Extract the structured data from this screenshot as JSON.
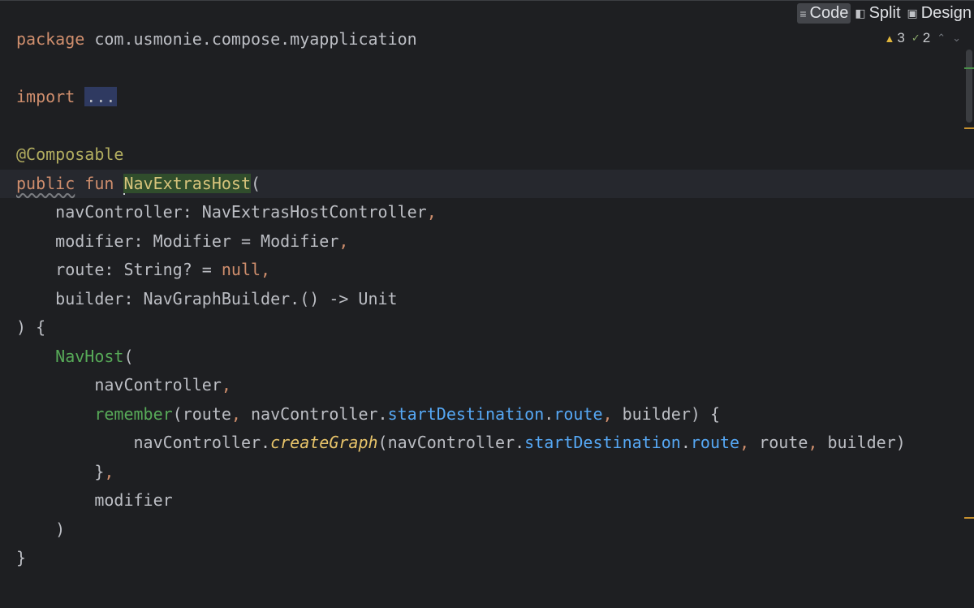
{
  "view_modes": [
    {
      "label": "Code",
      "icon": "lines-icon",
      "active": true
    },
    {
      "label": "Split",
      "icon": "split-icon",
      "active": false
    },
    {
      "label": "Design",
      "icon": "image-icon",
      "active": false
    }
  ],
  "inspections": {
    "warnings": "3",
    "weak_warnings": "2"
  },
  "colors": {
    "background": "#1e1f22",
    "keyword": "#cf8e6d",
    "annotation": "#b3ae60",
    "function_call": "#57aa58",
    "property_ref": "#56a8f5",
    "declaration_highlight": "#304d2c",
    "fold_highlight": "#2f3a61",
    "warning": "#e0b63c"
  },
  "code": {
    "l1_kw": "package",
    "l1_rest": " com.usmonie.compose.myapplication",
    "l3_kw": "import",
    "l3_fold": "...",
    "l5_ann": "@Composable",
    "l6_public": "public",
    "l6_fun": "fun",
    "l6_name": "NavExtrasHost",
    "l6_paren": "(",
    "l7": "    navController: NavExtrasHostController",
    "comma": ",",
    "l8": "    modifier: Modifier = Modifier",
    "l9_a": "    route: String? = ",
    "l9_null": "null",
    "l10": "    builder: NavGraphBuilder.() -> Unit",
    "l11": ") {",
    "l12_indent": "    ",
    "l12_call": "NavHost",
    "l12_paren": "(",
    "l13": "        navController",
    "l14_indent": "        ",
    "l14_call": "remember",
    "l14_a": "(route",
    "l14_b": " navController.",
    "l14_prop1": "startDestination",
    "l14_dot": ".",
    "l14_prop2": "route",
    "l14_c": " builder) {",
    "l15_a": "            navController.",
    "l15_ext": "createGraph",
    "l15_b": "(navController.",
    "l15_prop1": "startDestination",
    "l15_dot": ".",
    "l15_prop2": "route",
    "l15_c": " route",
    "l15_d": " builder)",
    "l16_a": "        }",
    "l17": "        modifier",
    "l18": "    )",
    "l19": "}"
  }
}
